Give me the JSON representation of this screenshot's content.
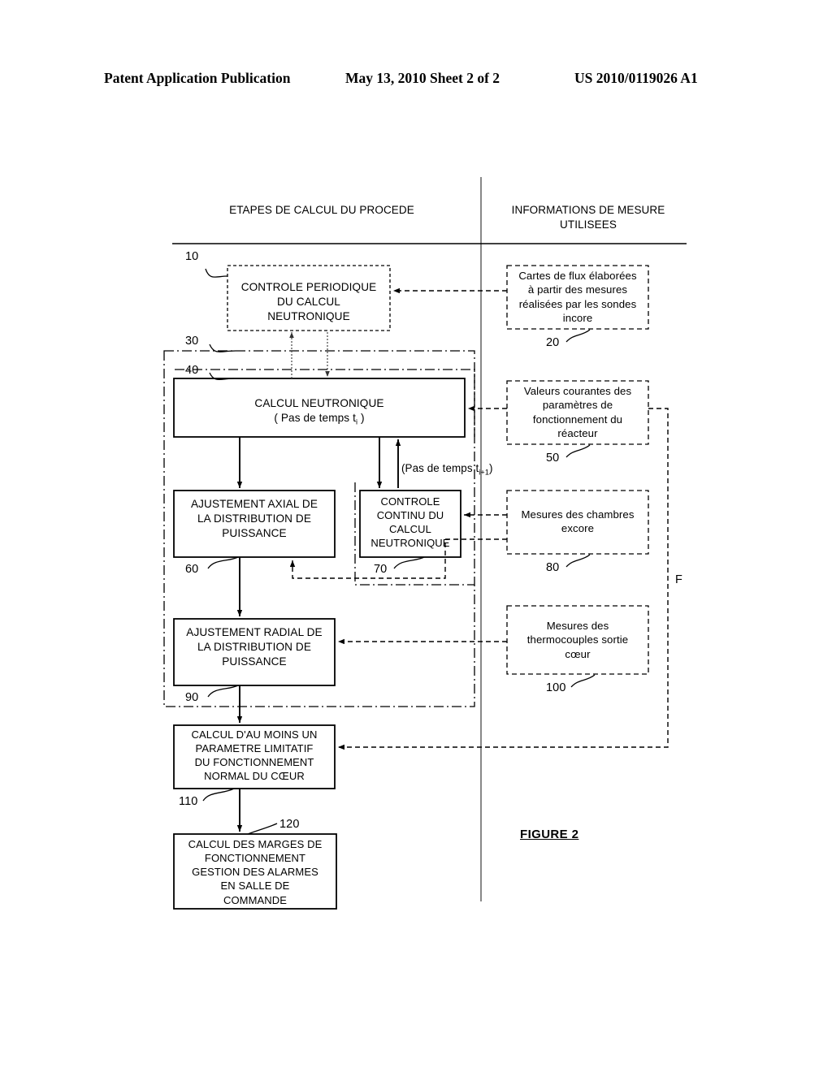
{
  "page_header": {
    "publication": "Patent Application Publication",
    "date_sheet": "May 13, 2010  Sheet 2 of 2",
    "document_number": "US 2010/0119026 A1"
  },
  "figure": {
    "caption": "FIGURE 2",
    "flow_marker": "F",
    "columns": [
      {
        "id": "left",
        "title": "ETAPES DE CALCUL DU PROCEDE"
      },
      {
        "id": "right",
        "title": "INFORMATIONS DE MESURE\nUTILISEES"
      }
    ],
    "process_boxes": [
      {
        "ref": "10",
        "border": "dashed",
        "text": "CONTROLE PERIODIQUE\nDU CALCUL\nNEUTRONIQUE"
      },
      {
        "ref": "30",
        "border": "dash-dot",
        "text": ""
      },
      {
        "ref": "40",
        "border": "solid",
        "text": "CALCUL NEUTRONIQUE"
      },
      {
        "ref": "60",
        "border": "solid",
        "text": "AJUSTEMENT AXIAL DE\nLA DISTRIBUTION DE\nPUISSANCE"
      },
      {
        "ref": "70",
        "border": "solid",
        "text": "CONTROLE\nCONTINU DU\nCALCUL\nNEUTRONIQUE"
      },
      {
        "ref": "90",
        "border": "solid",
        "text": "AJUSTEMENT RADIAL DE\nLA DISTRIBUTION DE\nPUISSANCE"
      },
      {
        "ref": "110",
        "border": "solid",
        "text": "CALCUL D'AU MOINS UN\nPARAMETRE LIMITATIF\nDU FONCTIONNEMENT\nNORMAL DU CŒUR"
      },
      {
        "ref": "120",
        "border": "solid",
        "text": "CALCUL DES MARGES DE\nFONCTIONNEMENT\nGESTION DES ALARMES\nEN SALLE DE\nCOMMANDE"
      }
    ],
    "measurement_boxes": [
      {
        "ref": "20",
        "text": "Cartes de flux élaborées\nà partir des mesures\nréalisées par les sondes\nincore"
      },
      {
        "ref": "50",
        "text": "Valeurs courantes des\nparamètres de\nfonctionnement du\nréacteur"
      },
      {
        "ref": "80",
        "text": "Mesures des chambres\nexcore"
      },
      {
        "ref": "100",
        "text": "Mesures des\nthermocouples sortie\ncœur"
      }
    ],
    "timestep_labels": {
      "current": "( Pas de temps t",
      "current_sub": "i",
      "current_end": " )",
      "next": "(Pas de temps t",
      "next_sub": "i+1",
      "next_end": ")"
    },
    "refs": {
      "r10": "10",
      "r20": "20",
      "r30": "30",
      "r40": "40",
      "r50": "50",
      "r60": "60",
      "r70": "70",
      "r80": "80",
      "r90": "90",
      "r100": "100",
      "r110": "110",
      "r120": "120"
    }
  }
}
